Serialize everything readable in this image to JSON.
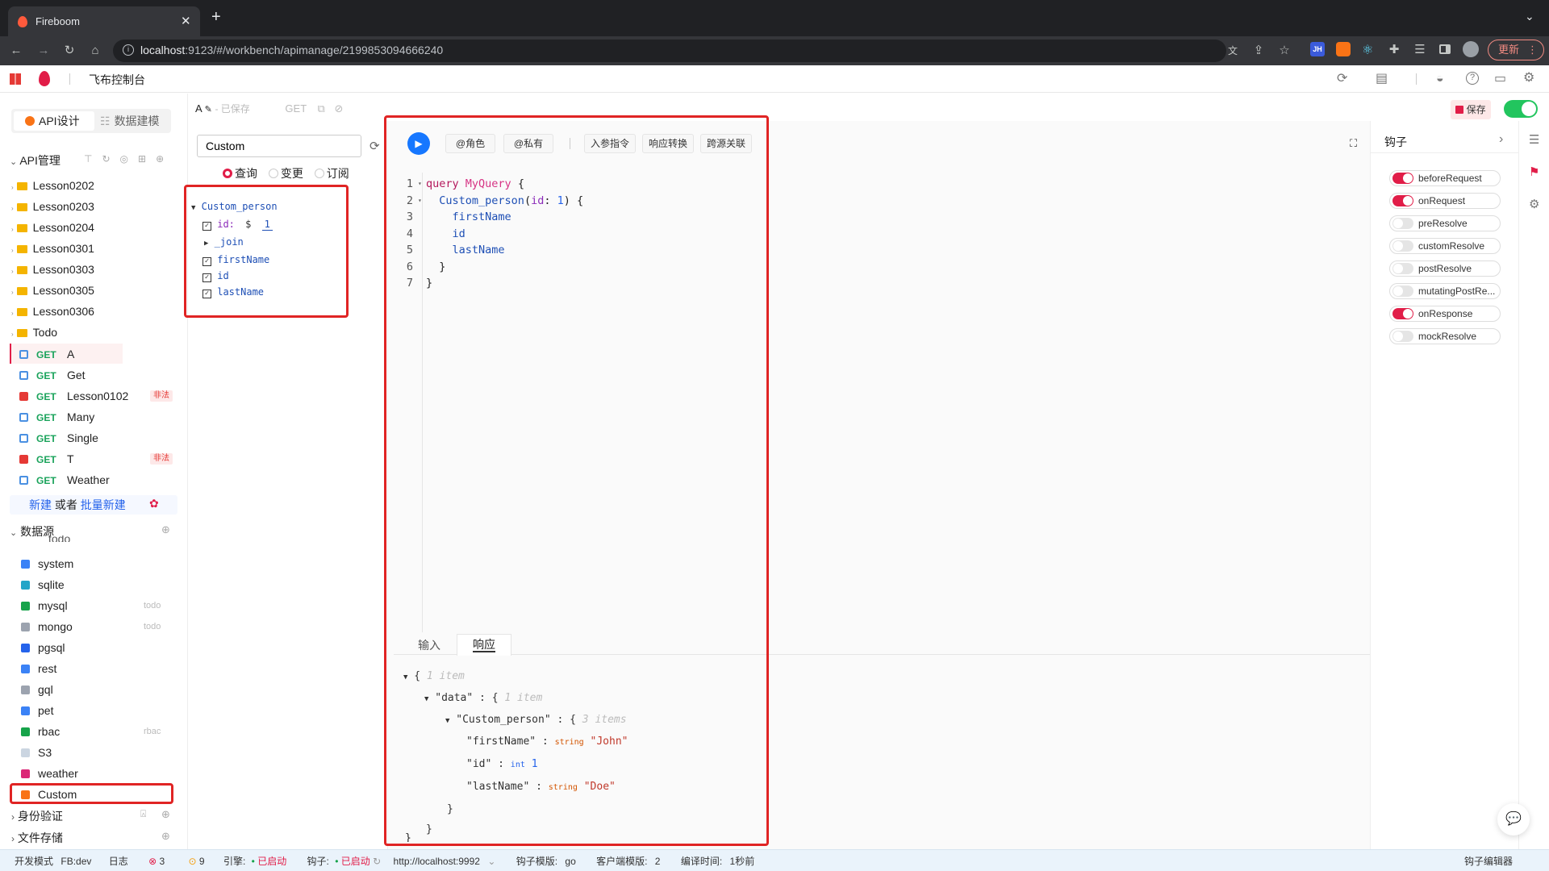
{
  "browser": {
    "tab_title": "Fireboom",
    "url_host": "localhost",
    "url_rest": ":9123/#/workbench/apimanage/2199853094666240",
    "update_label": "更新"
  },
  "app": {
    "title": "飞布控制台",
    "save_label": "保存"
  },
  "sidebar": {
    "tab_api": "API设计",
    "tab_model": "数据建模",
    "api_section": "API管理",
    "folders": [
      "Lesson0202",
      "Lesson0203",
      "Lesson0204",
      "Lesson0301",
      "Lesson0303",
      "Lesson0305",
      "Lesson0306",
      "Todo"
    ],
    "apis": [
      {
        "method": "GET",
        "name": "A",
        "illegal": ""
      },
      {
        "method": "GET",
        "name": "Get",
        "illegal": ""
      },
      {
        "method": "GET",
        "name": "Lesson0102",
        "illegal": "非法"
      },
      {
        "method": "GET",
        "name": "Many",
        "illegal": ""
      },
      {
        "method": "GET",
        "name": "Single",
        "illegal": ""
      },
      {
        "method": "GET",
        "name": "T",
        "illegal": "非法"
      },
      {
        "method": "GET",
        "name": "Weather",
        "illegal": ""
      }
    ],
    "new_label": "新建",
    "or_label": "或者",
    "batch_label": "批量新建",
    "ds_section": "数据源",
    "ds_partial": "todo",
    "datasources": [
      {
        "name": "system",
        "tag": "",
        "color": "#3b82f6"
      },
      {
        "name": "sqlite",
        "tag": "",
        "color": "#22a5c8"
      },
      {
        "name": "mysql",
        "tag": "todo",
        "color": "#16a34a"
      },
      {
        "name": "mongo",
        "tag": "todo",
        "color": "#9ca3af"
      },
      {
        "name": "pgsql",
        "tag": "",
        "color": "#2563eb"
      },
      {
        "name": "rest",
        "tag": "",
        "color": "#3b82f6"
      },
      {
        "name": "gql",
        "tag": "",
        "color": "#9ca3af"
      },
      {
        "name": "pet",
        "tag": "",
        "color": "#3b82f6"
      },
      {
        "name": "rbac",
        "tag": "rbac",
        "color": "#16a34a"
      },
      {
        "name": "S3",
        "tag": "",
        "color": "#cbd5e1"
      },
      {
        "name": "weather",
        "tag": "",
        "color": "#db2777"
      },
      {
        "name": "Custom",
        "tag": "",
        "color": "#f97316"
      }
    ],
    "auth_section": "身份验证",
    "storage_section": "文件存储"
  },
  "explorer": {
    "api_name": "A",
    "saved_status": "已保存",
    "method": "GET",
    "search_value": "Custom",
    "op_query": "查询",
    "op_mutation": "变更",
    "op_subscription": "订阅",
    "root_field": "Custom_person",
    "arg_label": "id:",
    "arg_dollar": "$",
    "arg_value": "1",
    "join_field": "_join",
    "fields": [
      "firstName",
      "id",
      "lastName"
    ]
  },
  "toolbar": {
    "role": "@角色",
    "private": "@私有",
    "input_directive": "入参指令",
    "response_transform": "响应转换",
    "cross_source": "跨源关联"
  },
  "editor": {
    "lines": [
      {
        "n": "1",
        "text": "query MyQuery {"
      },
      {
        "n": "2",
        "text": "  Custom_person(id: 1) {"
      },
      {
        "n": "3",
        "text": "    firstName"
      },
      {
        "n": "4",
        "text": "    id"
      },
      {
        "n": "5",
        "text": "    lastName"
      },
      {
        "n": "6",
        "text": "  }"
      },
      {
        "n": "7",
        "text": "}"
      }
    ]
  },
  "response": {
    "tab_input": "输入",
    "tab_response": "响应",
    "root_count": "1 item",
    "data_key": "\"data\"",
    "data_count": "1 item",
    "person_key": "\"Custom_person\"",
    "person_count": "3 items",
    "firstName_key": "\"firstName\"",
    "firstName_type": "string",
    "firstName_val": "\"John\"",
    "id_key": "\"id\"",
    "id_type": "int",
    "id_val": "1",
    "lastName_key": "\"lastName\"",
    "lastName_type": "string",
    "lastName_val": "\"Doe\""
  },
  "hooks": {
    "title": "钩子",
    "items": [
      {
        "name": "beforeRequest",
        "on": true
      },
      {
        "name": "onRequest",
        "on": true
      },
      {
        "name": "preResolve",
        "on": false
      },
      {
        "name": "customResolve",
        "on": false
      },
      {
        "name": "postResolve",
        "on": false
      },
      {
        "name": "mutatingPostRe...",
        "on": false
      },
      {
        "name": "onResponse",
        "on": true
      },
      {
        "name": "mockResolve",
        "on": false
      }
    ]
  },
  "statusbar": {
    "dev_mode": "开发模式",
    "fb": "FB:dev",
    "log": "日志",
    "errors": "3",
    "warnings": "9",
    "engine_label": "引擎:",
    "engine_status": "已启动",
    "hook_label": "钩子:",
    "hook_status": "已启动",
    "hook_url": "http://localhost:9992",
    "hook_template_label": "钩子模版:",
    "hook_template": "go",
    "client_template_label": "客户端模版:",
    "client_template": "2",
    "compile_label": "编译时间:",
    "compile_time": "1秒前",
    "hook_editor": "钩子编辑器"
  },
  "colors": {
    "accent": "#e11d48",
    "get": "#1aa35b",
    "highlight": "#e02424",
    "toggle_on": "#22c55e"
  }
}
